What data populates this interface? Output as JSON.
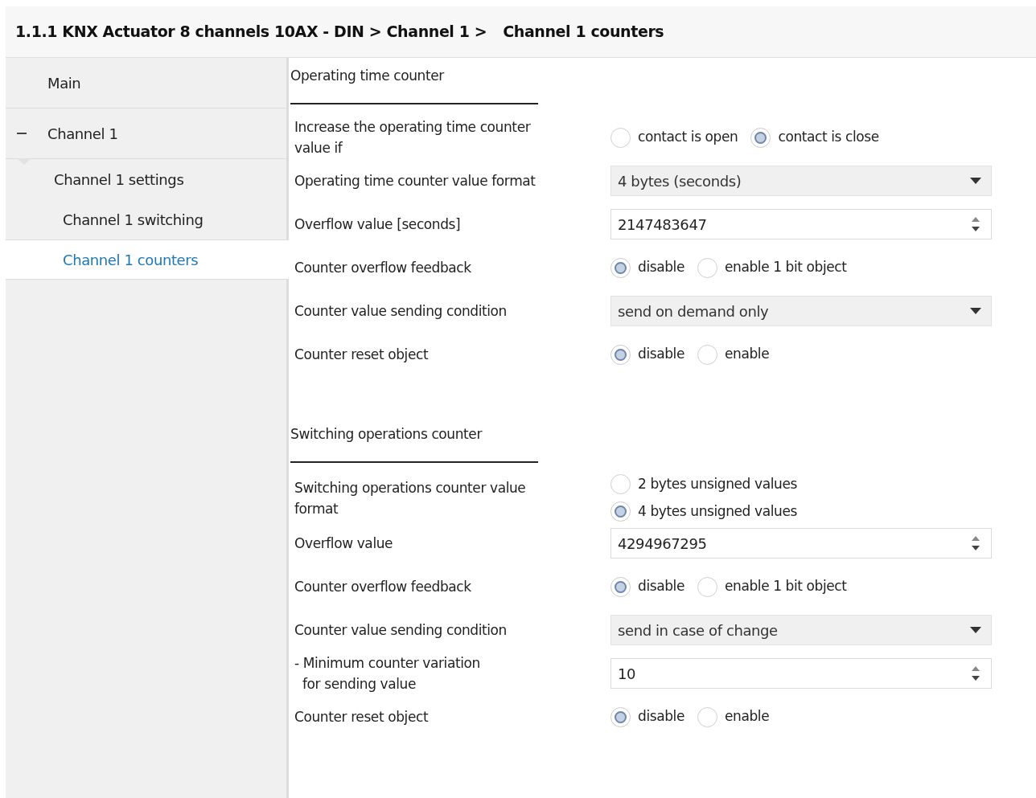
{
  "breadcrumb": {
    "path": "1.1.1 KNX Actuator 8 channels 10AX - DIN > Channel 1 >",
    "current": "Channel 1 counters"
  },
  "sidebar": {
    "items": [
      {
        "label": "Main",
        "selected": false
      },
      {
        "label": "Channel 1",
        "selected": false,
        "expanded": true,
        "children": [
          {
            "label": "Channel 1 settings",
            "selected": false,
            "children": [
              {
                "label": "Channel 1 switching",
                "selected": false
              },
              {
                "label": "Channel 1 counters",
                "selected": true
              }
            ]
          }
        ]
      }
    ]
  },
  "sections": [
    {
      "title": "Operating time counter",
      "params": [
        {
          "kind": "radio",
          "label": "Increase the operating time counter value if",
          "options": [
            {
              "label": "contact is open",
              "selected": false
            },
            {
              "label": "contact is close",
              "selected": true
            }
          ]
        },
        {
          "kind": "select",
          "label": "Operating time counter value format",
          "value": "4 bytes (seconds)"
        },
        {
          "kind": "spin",
          "label": "Overflow value [seconds]",
          "value": "2147483647"
        },
        {
          "kind": "radio",
          "label": "Counter overflow feedback",
          "options": [
            {
              "label": "disable",
              "selected": true
            },
            {
              "label": "enable 1 bit object",
              "selected": false
            }
          ]
        },
        {
          "kind": "select",
          "label": "Counter value sending condition",
          "value": "send on demand only"
        },
        {
          "kind": "radio",
          "label": "Counter reset object",
          "options": [
            {
              "label": "disable",
              "selected": true
            },
            {
              "label": "enable",
              "selected": false
            }
          ]
        }
      ]
    },
    {
      "title": "Switching operations counter",
      "params": [
        {
          "kind": "radio_stacked",
          "label": "Switching operations counter value format",
          "options": [
            {
              "label": "2 bytes unsigned values",
              "selected": false
            },
            {
              "label": "4 bytes unsigned values",
              "selected": true
            }
          ]
        },
        {
          "kind": "spin",
          "label": "Overflow value",
          "value": "4294967295"
        },
        {
          "kind": "radio",
          "label": "Counter overflow feedback",
          "options": [
            {
              "label": "disable",
              "selected": true
            },
            {
              "label": "enable 1 bit object",
              "selected": false
            }
          ]
        },
        {
          "kind": "select",
          "label": "Counter value sending condition",
          "value": "send in case of change"
        },
        {
          "kind": "spin",
          "label": "- Minimum counter variation\n  for sending value",
          "value": "10"
        },
        {
          "kind": "radio",
          "label": "Counter reset object",
          "options": [
            {
              "label": "disable",
              "selected": true
            },
            {
              "label": "enable",
              "selected": false
            }
          ]
        }
      ]
    }
  ]
}
